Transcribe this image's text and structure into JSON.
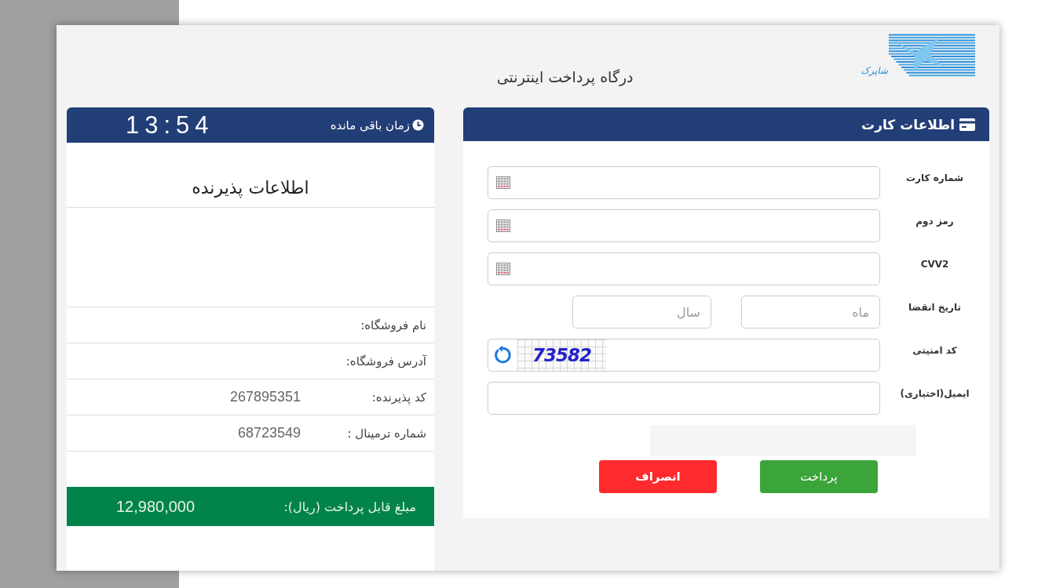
{
  "header": {
    "logo_text": "شاپرک",
    "title": "درگاه پرداخت اینترنتی"
  },
  "card_panel": {
    "title": "اطلاعات کارت",
    "fields": [
      {
        "kind": "keypad",
        "label": "شماره کارت"
      },
      {
        "kind": "keypad",
        "label": "رمز دوم"
      },
      {
        "kind": "keypad",
        "label": "CVV2"
      },
      {
        "kind": "expiry",
        "label": "تاریخ انقضا",
        "month_placeholder": "ماه",
        "year_placeholder": "سال"
      },
      {
        "kind": "captcha",
        "label": "کد امنیتی",
        "captcha": "73582"
      },
      {
        "kind": "plain",
        "label": "ایمیل(اختیاری)"
      }
    ],
    "buttons": [
      {
        "kind": "pay",
        "label": "پرداخت"
      },
      {
        "kind": "cancel",
        "label": "انصراف"
      }
    ]
  },
  "merchant_panel": {
    "timer_label": "زمان باقی مانده",
    "timer": "13:54",
    "title": "اطلاعات پذیرنده",
    "rows": [
      {
        "label": "نام فروشگاه:"
      },
      {
        "label": "آدرس فروشگاه:"
      },
      {
        "label": "کد پذیرنده:",
        "value": "267895351"
      },
      {
        "label": "شماره ترمینال :",
        "value": "68723549"
      }
    ],
    "amount": {
      "label": "مبلغ قابل پرداخت (ریال):",
      "value": "12,980,000"
    }
  }
}
